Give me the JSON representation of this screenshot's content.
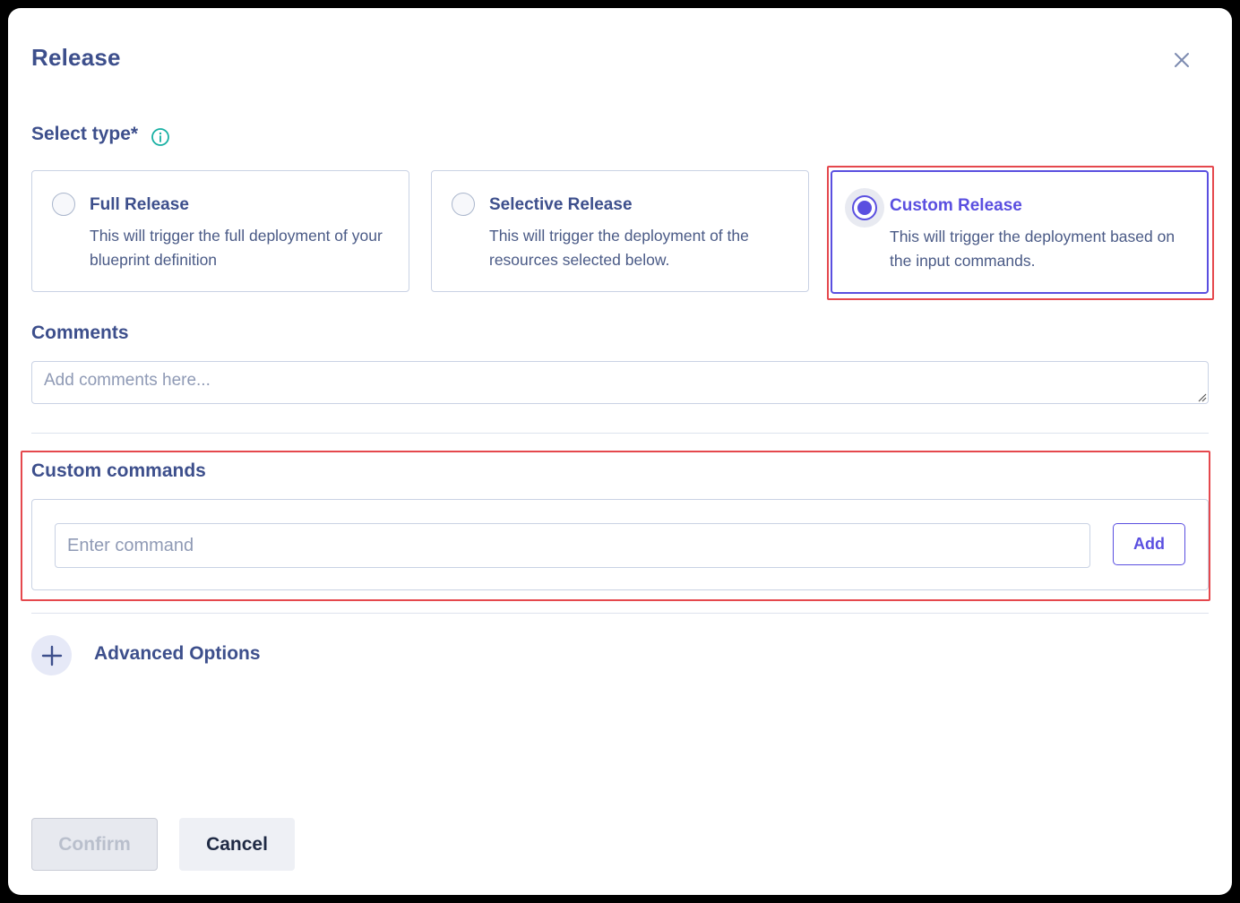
{
  "dialog": {
    "title": "Release",
    "close_icon": "close-icon"
  },
  "select_type": {
    "label": "Select type*",
    "info_icon": "info-icon",
    "options": [
      {
        "title": "Full Release",
        "description": "This will trigger the full deployment of your blueprint definition",
        "selected": false
      },
      {
        "title": "Selective Release",
        "description": "This will trigger the deployment of the resources selected below.",
        "selected": false
      },
      {
        "title": "Custom Release",
        "description": "This will trigger the deployment based on the input commands.",
        "selected": true
      }
    ]
  },
  "comments": {
    "label": "Comments",
    "placeholder": "Add comments here...",
    "value": ""
  },
  "custom_commands": {
    "label": "Custom commands",
    "input_placeholder": "Enter command",
    "input_value": "",
    "add_label": "Add"
  },
  "advanced_options": {
    "label": "Advanced Options",
    "icon": "plus-icon"
  },
  "footer": {
    "confirm_label": "Confirm",
    "confirm_disabled": true,
    "cancel_label": "Cancel"
  },
  "colors": {
    "primary_text": "#3d4f8c",
    "accent": "#5a4fe0",
    "highlight": "#e5484d",
    "info": "#17b0a3",
    "border": "#c9d2e4"
  }
}
